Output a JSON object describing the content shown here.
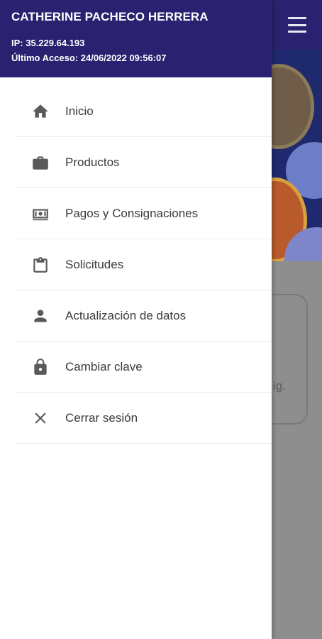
{
  "user": {
    "name": "CATHERINE PACHECO HERRERA",
    "ip": "IP: 35.229.64.193",
    "last_access": "Último Acceso: 24/06/2022 09:56:07"
  },
  "menu": {
    "items": [
      {
        "label": "Inicio",
        "icon": "home-icon"
      },
      {
        "label": "Productos",
        "icon": "briefcase-icon"
      },
      {
        "label": "Pagos y Consignaciones",
        "icon": "money-icon"
      },
      {
        "label": "Solicitudes",
        "icon": "clipboard-icon"
      },
      {
        "label": "Actualización de datos",
        "icon": "person-icon"
      },
      {
        "label": "Cambiar clave",
        "icon": "lock-icon"
      },
      {
        "label": "Cerrar sesión",
        "icon": "close-icon"
      }
    ]
  },
  "background": {
    "card_text_fragment": "ig."
  },
  "colors": {
    "header_bg": "#2a2270",
    "icon": "#5a5a5a",
    "text": "#3a3a3a"
  }
}
